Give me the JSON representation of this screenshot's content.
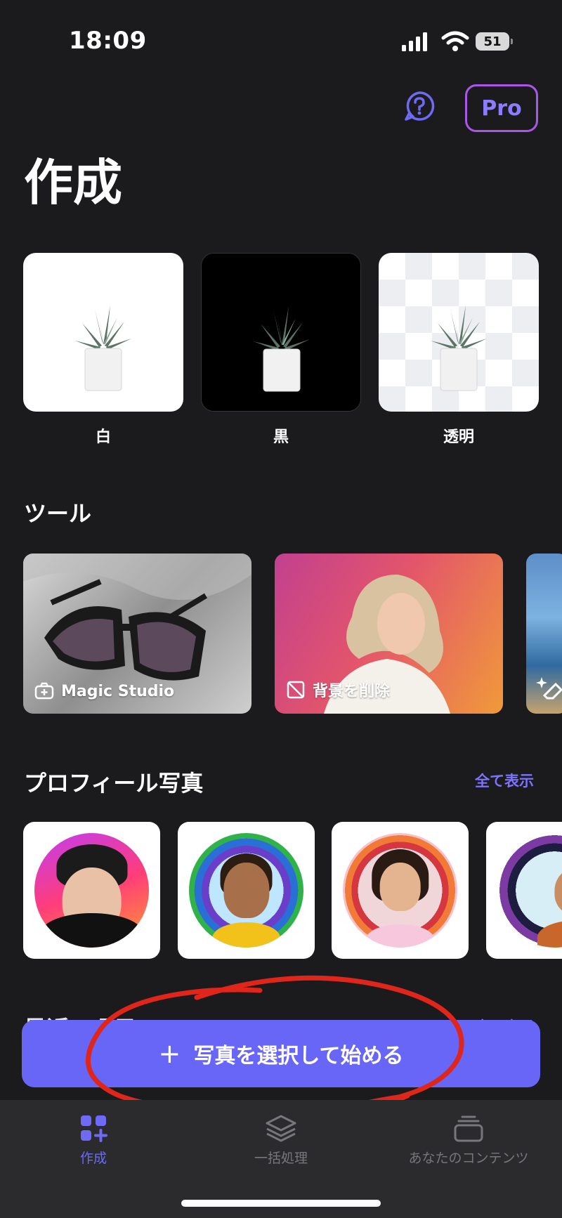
{
  "status": {
    "time": "18:09",
    "battery": "51"
  },
  "header": {
    "pro_label": "Pro",
    "title": "作成"
  },
  "backgrounds": [
    {
      "label": "白"
    },
    {
      "label": "黒"
    },
    {
      "label": "透明"
    }
  ],
  "tools": {
    "title": "ツール",
    "items": [
      {
        "label": "Magic Studio"
      },
      {
        "label": "背景を削除"
      }
    ]
  },
  "profile": {
    "title": "プロフィール写真",
    "show_all": "全て表示"
  },
  "recent": {
    "title": "最近の項目",
    "show_all": "全て表示"
  },
  "start_button": {
    "label": "写真を選択して始める"
  },
  "tabbar": {
    "items": [
      {
        "label": "作成"
      },
      {
        "label": "一括処理"
      },
      {
        "label": "あなたのコンテンツ"
      }
    ]
  },
  "colors": {
    "accent": "#6866f6",
    "annotation": "#e0251b"
  }
}
